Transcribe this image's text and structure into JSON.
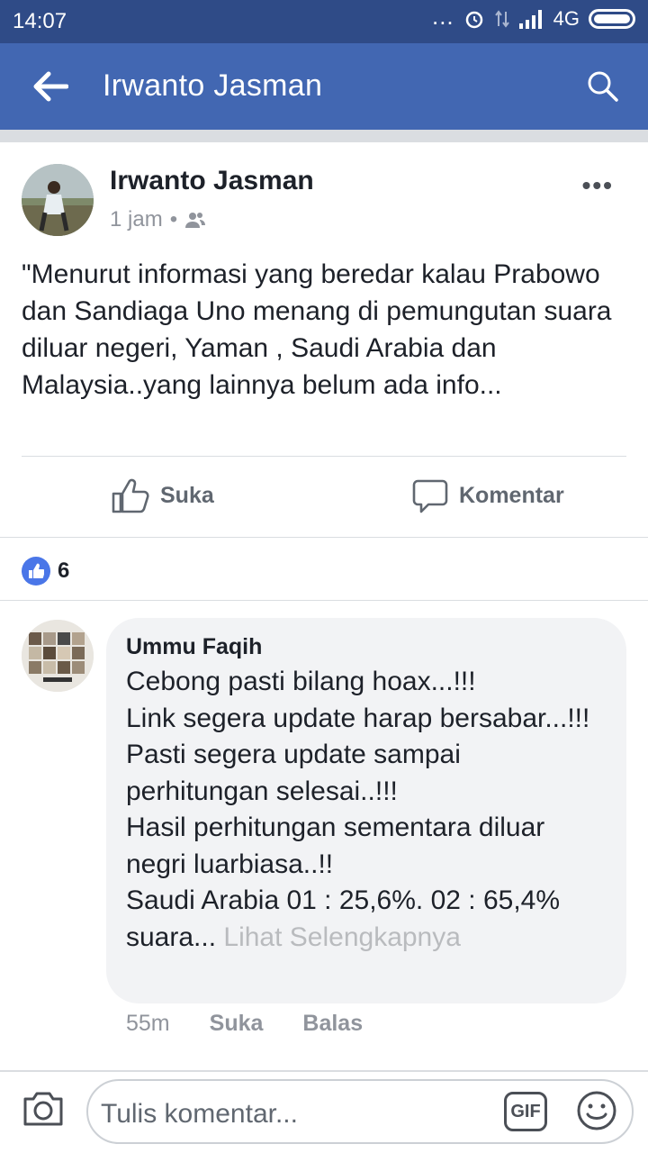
{
  "status_bar": {
    "time": "14:07",
    "network": "4G",
    "dots": "..."
  },
  "app_bar": {
    "title": "Irwanto Jasman"
  },
  "post": {
    "author": "Irwanto Jasman",
    "time": "1 jam",
    "separator": "•",
    "text": "\"Menurut informasi yang beredar kalau Prabowo dan Sandiaga Uno menang di pemungutan suara diluar negeri, Yaman , Saudi Arabia dan Malaysia..yang lainnya belum ada info...",
    "more": "•••"
  },
  "actions": {
    "like_label": "Suka",
    "comment_label": "Komentar"
  },
  "reactions": {
    "count": "6"
  },
  "comment": {
    "author": "Ummu Faqih",
    "text": "Cebong pasti bilang hoax...!!!\nLink segera update harap bersabar...!!!\nPasti segera update sampai perhitungan selesai..!!!\nHasil perhitungan sementara diluar negri luarbiasa..!!\nSaudi Arabia 01  : 25,6%.       02 : 65,4% suara... ",
    "see_more": "Lihat Selengkapnya",
    "time": "55m",
    "like_label": "Suka",
    "reply_label": "Balas"
  },
  "composer": {
    "placeholder": "Tulis komentar...",
    "gif_label": "GIF"
  },
  "colors": {
    "status_bar": "#2f4b87",
    "app_bar": "#4267b2",
    "like_blue": "#4a76e8"
  }
}
